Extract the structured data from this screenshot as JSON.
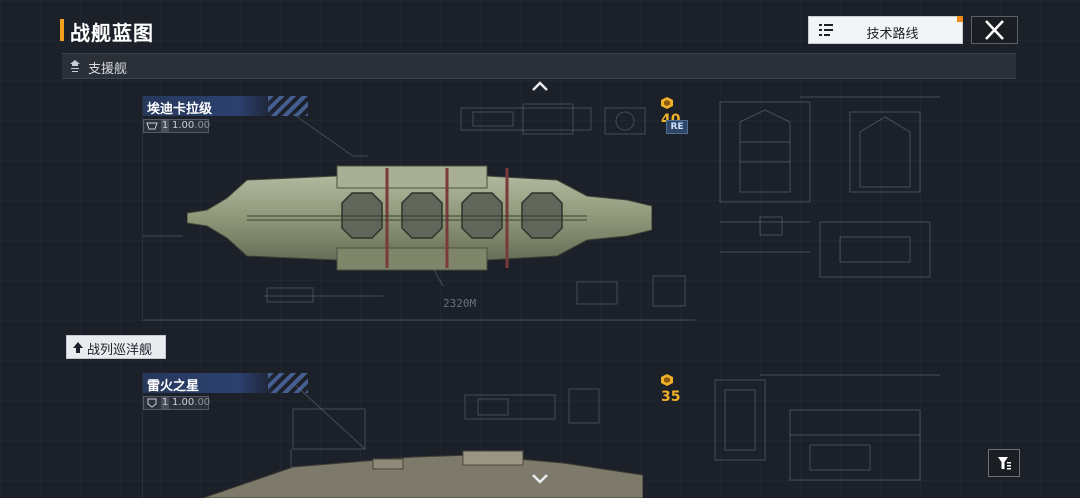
{
  "header": {
    "title": "战舰蓝图",
    "tech_button_label": "技术路线"
  },
  "section": {
    "label": "支援舰"
  },
  "ships": [
    {
      "name": "埃迪卡拉级",
      "rating_level": "1",
      "rating_value": "1.00",
      "rating_dim": ".00",
      "cost": "40",
      "badge": "RE",
      "length": "2320M"
    },
    {
      "name": "雷火之星",
      "rating_level": "1",
      "rating_value": "1.00",
      "rating_dim": ".00",
      "cost": "35"
    }
  ],
  "category_tab": {
    "label": "战列巡洋舰"
  },
  "colors": {
    "accent": "#f0a01c",
    "cost": "#f0b02a",
    "name_tag": "#2c4170",
    "background": "#1b2029"
  },
  "icons": {
    "tech_button": "tech-tree-icon",
    "close": "close-icon",
    "section": "support-ship-icon",
    "category": "battlecruiser-icon",
    "filter": "filter-icon",
    "cost": "coin-icon",
    "collapse": "chevron-up-icon"
  }
}
